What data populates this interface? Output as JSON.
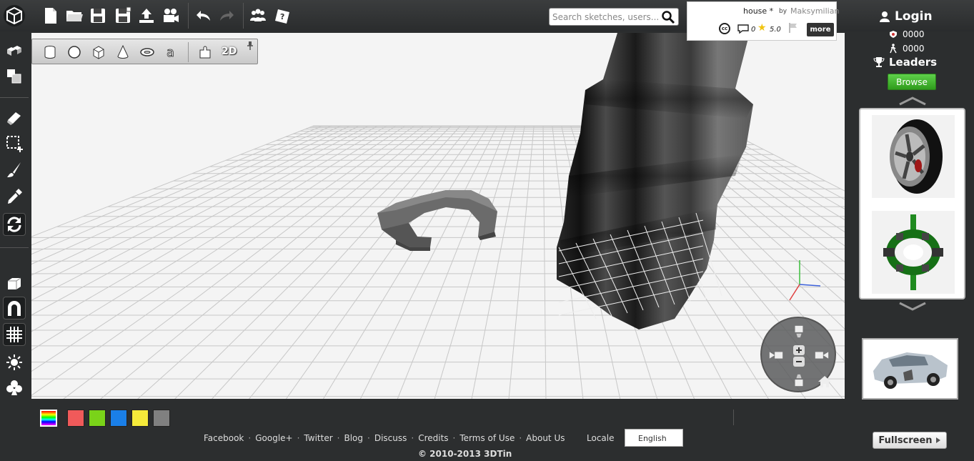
{
  "search": {
    "placeholder": "Search sketches, users..."
  },
  "model_info": {
    "title": "house *",
    "by": "by",
    "author": "Maksymilian",
    "license": "cc",
    "comment_count": "0",
    "rating": "5.0",
    "more_label": "more"
  },
  "account": {
    "login_label": "Login",
    "stat_1": "0000",
    "stat_2": "0000",
    "leaders_label": "Leaders",
    "browse_label": "Browse"
  },
  "toolbar": {
    "icons": [
      "new-file-icon",
      "open-folder-icon",
      "save-icon",
      "save-as-icon",
      "upload-icon",
      "video-camera-icon",
      "undo-icon",
      "redo-icon",
      "community-icon",
      "help-icon"
    ]
  },
  "shapes_toolbar": {
    "label_2d": "2D",
    "icons": [
      "cylinder-icon",
      "sphere-icon",
      "cube-icon",
      "cone-icon",
      "torus-icon",
      "text-shape-icon",
      "puzzle-icon"
    ]
  },
  "palette": {
    "colors": [
      "#f05a5a",
      "#7ad319",
      "#1a7fe8",
      "#f5ea3a",
      "#808080"
    ]
  },
  "footer": {
    "links": [
      "Facebook",
      "Google+",
      "Twitter",
      "Blog",
      "Discuss",
      "Credits",
      "Terms of Use",
      "About Us"
    ],
    "locale_label": "Locale",
    "language": "English",
    "copyright": "© 2010-2013 3DTin",
    "fullscreen_label": "Fullscreen"
  }
}
